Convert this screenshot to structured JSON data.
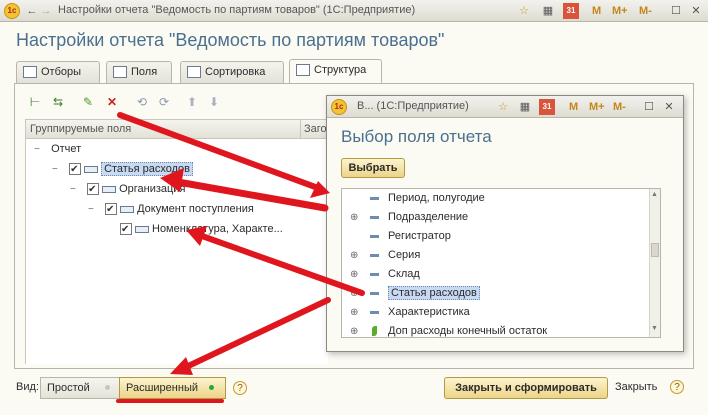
{
  "window": {
    "title": "Настройки отчета \"Ведомость по партиям товаров\"  (1С:Предприятие)",
    "logo_text": "1с",
    "mem_buttons": [
      "M",
      "M+",
      "M-"
    ],
    "calendar_day": "31"
  },
  "page_title": "Настройки отчета \"Ведомость по партиям товаров\"",
  "tabs": [
    {
      "label": "Отборы"
    },
    {
      "label": "Поля"
    },
    {
      "label": "Сортировка"
    },
    {
      "label": "Структура",
      "active": true
    }
  ],
  "grid": {
    "col1_header": "Группируемые поля",
    "col2_header": "Заго",
    "rows": [
      {
        "label": "Отчет",
        "level": 0,
        "checkbox": false,
        "expander": "−"
      },
      {
        "label": "Статья расходов",
        "level": 1,
        "checkbox": true,
        "expander": "−",
        "selected": true
      },
      {
        "label": "Организация",
        "level": 2,
        "checkbox": true,
        "expander": "−"
      },
      {
        "label": "Документ поступления",
        "level": 3,
        "checkbox": true,
        "expander": "−"
      },
      {
        "label": "Номенклатура, Характе...",
        "level": 4,
        "checkbox": true,
        "expander": ""
      }
    ]
  },
  "dialog": {
    "title": "В...  (1С:Предприятие)",
    "logo_text": "1с",
    "mem_buttons": [
      "M",
      "M+",
      "M-"
    ],
    "calendar_day": "31",
    "heading": "Выбор поля отчета",
    "select_button": "Выбрать",
    "items": [
      {
        "label": "Период, полугодие",
        "expandable": false,
        "icon": "dash"
      },
      {
        "label": "Подразделение",
        "expandable": true,
        "icon": "dash"
      },
      {
        "label": "Регистратор",
        "expandable": false,
        "icon": "dash"
      },
      {
        "label": "Серия",
        "expandable": true,
        "icon": "dash"
      },
      {
        "label": "Склад",
        "expandable": true,
        "icon": "dash"
      },
      {
        "label": "Статья расходов",
        "expandable": true,
        "icon": "dash",
        "selected": true
      },
      {
        "label": "Характеристика",
        "expandable": true,
        "icon": "dash"
      },
      {
        "label": "Доп расходы конечный остаток",
        "expandable": true,
        "icon": "leaf"
      }
    ]
  },
  "footer": {
    "view_label": "Вид:",
    "simple": "Простой",
    "extended": "Расширенный",
    "help": "?",
    "generate_button": "Закрыть и сформировать",
    "close": "Закрыть",
    "help2": "?"
  },
  "colors": {
    "accent_title": "#4a7090",
    "annotation_red": "#e0161e",
    "selection": "#c7daf1",
    "button_yellow": "#ecd488"
  }
}
